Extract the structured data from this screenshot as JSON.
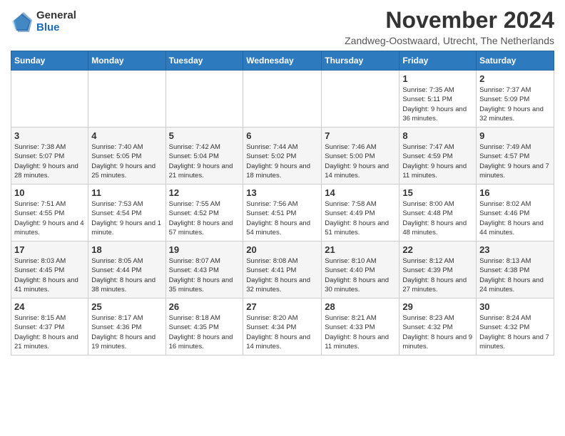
{
  "header": {
    "logo_general": "General",
    "logo_blue": "Blue",
    "title": "November 2024",
    "location": "Zandweg-Oostwaard, Utrecht, The Netherlands"
  },
  "days_of_week": [
    "Sunday",
    "Monday",
    "Tuesday",
    "Wednesday",
    "Thursday",
    "Friday",
    "Saturday"
  ],
  "weeks": [
    [
      {
        "day": "",
        "info": ""
      },
      {
        "day": "",
        "info": ""
      },
      {
        "day": "",
        "info": ""
      },
      {
        "day": "",
        "info": ""
      },
      {
        "day": "",
        "info": ""
      },
      {
        "day": "1",
        "info": "Sunrise: 7:35 AM\nSunset: 5:11 PM\nDaylight: 9 hours and 36 minutes."
      },
      {
        "day": "2",
        "info": "Sunrise: 7:37 AM\nSunset: 5:09 PM\nDaylight: 9 hours and 32 minutes."
      }
    ],
    [
      {
        "day": "3",
        "info": "Sunrise: 7:38 AM\nSunset: 5:07 PM\nDaylight: 9 hours and 28 minutes."
      },
      {
        "day": "4",
        "info": "Sunrise: 7:40 AM\nSunset: 5:05 PM\nDaylight: 9 hours and 25 minutes."
      },
      {
        "day": "5",
        "info": "Sunrise: 7:42 AM\nSunset: 5:04 PM\nDaylight: 9 hours and 21 minutes."
      },
      {
        "day": "6",
        "info": "Sunrise: 7:44 AM\nSunset: 5:02 PM\nDaylight: 9 hours and 18 minutes."
      },
      {
        "day": "7",
        "info": "Sunrise: 7:46 AM\nSunset: 5:00 PM\nDaylight: 9 hours and 14 minutes."
      },
      {
        "day": "8",
        "info": "Sunrise: 7:47 AM\nSunset: 4:59 PM\nDaylight: 9 hours and 11 minutes."
      },
      {
        "day": "9",
        "info": "Sunrise: 7:49 AM\nSunset: 4:57 PM\nDaylight: 9 hours and 7 minutes."
      }
    ],
    [
      {
        "day": "10",
        "info": "Sunrise: 7:51 AM\nSunset: 4:55 PM\nDaylight: 9 hours and 4 minutes."
      },
      {
        "day": "11",
        "info": "Sunrise: 7:53 AM\nSunset: 4:54 PM\nDaylight: 9 hours and 1 minute."
      },
      {
        "day": "12",
        "info": "Sunrise: 7:55 AM\nSunset: 4:52 PM\nDaylight: 8 hours and 57 minutes."
      },
      {
        "day": "13",
        "info": "Sunrise: 7:56 AM\nSunset: 4:51 PM\nDaylight: 8 hours and 54 minutes."
      },
      {
        "day": "14",
        "info": "Sunrise: 7:58 AM\nSunset: 4:49 PM\nDaylight: 8 hours and 51 minutes."
      },
      {
        "day": "15",
        "info": "Sunrise: 8:00 AM\nSunset: 4:48 PM\nDaylight: 8 hours and 48 minutes."
      },
      {
        "day": "16",
        "info": "Sunrise: 8:02 AM\nSunset: 4:46 PM\nDaylight: 8 hours and 44 minutes."
      }
    ],
    [
      {
        "day": "17",
        "info": "Sunrise: 8:03 AM\nSunset: 4:45 PM\nDaylight: 8 hours and 41 minutes."
      },
      {
        "day": "18",
        "info": "Sunrise: 8:05 AM\nSunset: 4:44 PM\nDaylight: 8 hours and 38 minutes."
      },
      {
        "day": "19",
        "info": "Sunrise: 8:07 AM\nSunset: 4:43 PM\nDaylight: 8 hours and 35 minutes."
      },
      {
        "day": "20",
        "info": "Sunrise: 8:08 AM\nSunset: 4:41 PM\nDaylight: 8 hours and 32 minutes."
      },
      {
        "day": "21",
        "info": "Sunrise: 8:10 AM\nSunset: 4:40 PM\nDaylight: 8 hours and 30 minutes."
      },
      {
        "day": "22",
        "info": "Sunrise: 8:12 AM\nSunset: 4:39 PM\nDaylight: 8 hours and 27 minutes."
      },
      {
        "day": "23",
        "info": "Sunrise: 8:13 AM\nSunset: 4:38 PM\nDaylight: 8 hours and 24 minutes."
      }
    ],
    [
      {
        "day": "24",
        "info": "Sunrise: 8:15 AM\nSunset: 4:37 PM\nDaylight: 8 hours and 21 minutes."
      },
      {
        "day": "25",
        "info": "Sunrise: 8:17 AM\nSunset: 4:36 PM\nDaylight: 8 hours and 19 minutes."
      },
      {
        "day": "26",
        "info": "Sunrise: 8:18 AM\nSunset: 4:35 PM\nDaylight: 8 hours and 16 minutes."
      },
      {
        "day": "27",
        "info": "Sunrise: 8:20 AM\nSunset: 4:34 PM\nDaylight: 8 hours and 14 minutes."
      },
      {
        "day": "28",
        "info": "Sunrise: 8:21 AM\nSunset: 4:33 PM\nDaylight: 8 hours and 11 minutes."
      },
      {
        "day": "29",
        "info": "Sunrise: 8:23 AM\nSunset: 4:32 PM\nDaylight: 8 hours and 9 minutes."
      },
      {
        "day": "30",
        "info": "Sunrise: 8:24 AM\nSunset: 4:32 PM\nDaylight: 8 hours and 7 minutes."
      }
    ]
  ]
}
